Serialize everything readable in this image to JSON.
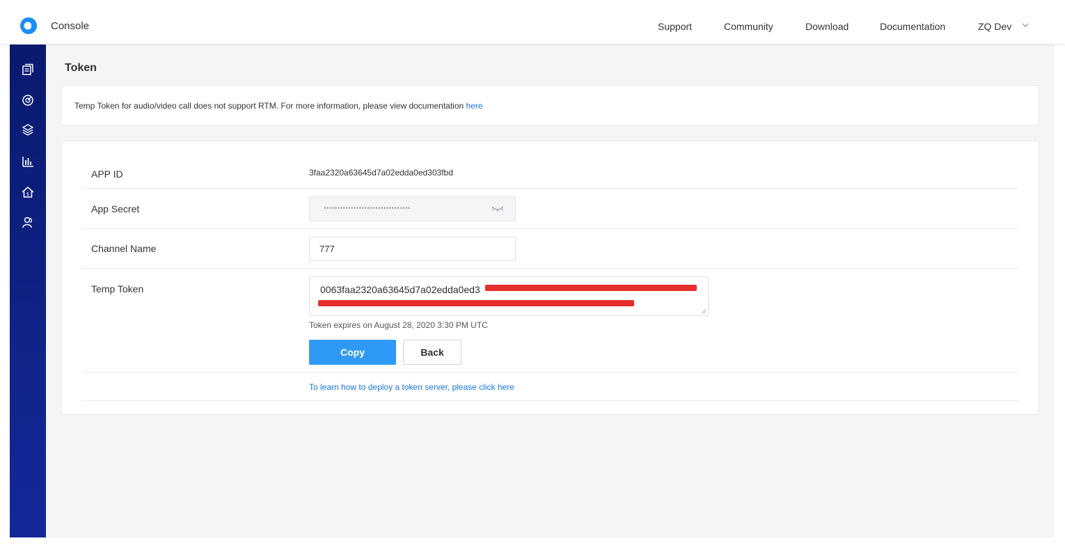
{
  "header": {
    "brand": "Console",
    "nav": [
      "Support",
      "Community",
      "Download",
      "Documentation"
    ],
    "user": "ZQ Dev",
    "logo_icon": "agora-logo-icon",
    "chevron_icon": "chevron-down-icon"
  },
  "sidebar": {
    "icons": [
      "project-list-icon",
      "dashboard-gauge-icon",
      "layers-icon",
      "usage-bar-chart-icon",
      "billing-home-icon",
      "members-icon"
    ]
  },
  "page": {
    "title": "Token",
    "notice_text": "Temp Token for audio/video call does not support RTM. For more information, please view documentation ",
    "notice_link": "here"
  },
  "form": {
    "app_id_label": "APP ID",
    "app_id_value": "3faa2320a63645d7a02edda0ed303fbd",
    "app_secret_label": "App Secret",
    "app_secret_masked": "••••••••••••••••••••••••••••••••",
    "channel_label": "Channel Name",
    "channel_value": "777",
    "token_label": "Temp Token",
    "token_value": "0063faa2320a63645d7a02edda0ed3",
    "expires_text": "Token expires on August 28, 2020 3:30 PM UTC",
    "copy_label": "Copy",
    "back_label": "Back",
    "deploy_link": "To learn how to deploy a token server, please click here"
  },
  "colors": {
    "sidebar_top": "#0a1a6e",
    "sidebar_bottom": "#13299a",
    "accent": "#2f9af5",
    "link": "#1776e6",
    "redaction": "#e62e2e",
    "background": "#f5f5f6"
  }
}
